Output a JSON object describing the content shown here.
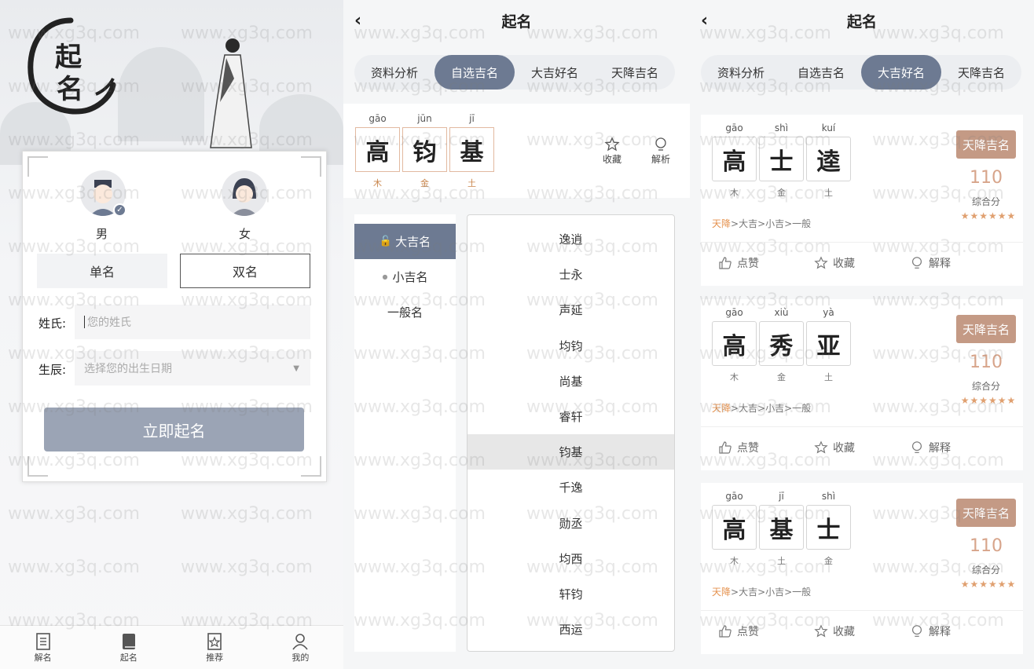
{
  "panel1": {
    "logo_chars": [
      "起",
      "名"
    ],
    "male_label": "男",
    "female_label": "女",
    "single_name": "单名",
    "double_name": "双名",
    "surname_label": "姓氏:",
    "surname_placeholder": "您的姓氏",
    "birth_label": "生辰:",
    "birth_placeholder": "选择您的出生日期",
    "submit_label": "立即起名",
    "tabs": [
      {
        "label": "解名",
        "icon": "book-open-icon"
      },
      {
        "label": "起名",
        "icon": "book-icon"
      },
      {
        "label": "推荐",
        "icon": "star-doc-icon"
      },
      {
        "label": "我的",
        "icon": "user-icon"
      }
    ]
  },
  "panel2": {
    "title": "起名",
    "tabs": [
      "资料分析",
      "自选吉名",
      "大吉好名",
      "天降吉名"
    ],
    "active_tab": 1,
    "chars": [
      {
        "py": "gāo",
        "ch": "高",
        "wx": "木"
      },
      {
        "py": "jūn",
        "ch": "钧",
        "wx": "金"
      },
      {
        "py": "jī",
        "ch": "基",
        "wx": "土"
      }
    ],
    "favorite_label": "收藏",
    "analysis_label": "解析",
    "categories": [
      "大吉名",
      "小吉名",
      "一般名"
    ],
    "names": [
      "逸逍",
      "士永",
      "声延",
      "均钧",
      "尚基",
      "睿轩",
      "钧基",
      "千逸",
      "勋丞",
      "均西",
      "轩钧",
      "西运"
    ],
    "selected_index": 6
  },
  "panel3": {
    "title": "起名",
    "tabs": [
      "资料分析",
      "自选吉名",
      "大吉好名",
      "天降吉名"
    ],
    "active_tab": 2,
    "badge": "天降吉名",
    "score_label": "综合分",
    "rank_hl": "天降",
    "rank_rest": ">大吉>小吉>一般",
    "like_label": "点赞",
    "fav_label": "收藏",
    "explain_label": "解释",
    "stars": "★★★★★★",
    "cards": [
      {
        "score": "110",
        "chars": [
          {
            "py": "gāo",
            "ch": "高",
            "wx": "木"
          },
          {
            "py": "shì",
            "ch": "士",
            "wx": "金"
          },
          {
            "py": "kuí",
            "ch": "逵",
            "wx": "土"
          }
        ]
      },
      {
        "score": "110",
        "chars": [
          {
            "py": "gāo",
            "ch": "高",
            "wx": "木"
          },
          {
            "py": "xiù",
            "ch": "秀",
            "wx": "金"
          },
          {
            "py": "yà",
            "ch": "亚",
            "wx": "土"
          }
        ]
      },
      {
        "score": "110",
        "chars": [
          {
            "py": "gāo",
            "ch": "高",
            "wx": "木"
          },
          {
            "py": "jī",
            "ch": "基",
            "wx": "土"
          },
          {
            "py": "shì",
            "ch": "士",
            "wx": "金"
          }
        ]
      }
    ]
  },
  "watermark": "www.xg3q.com"
}
